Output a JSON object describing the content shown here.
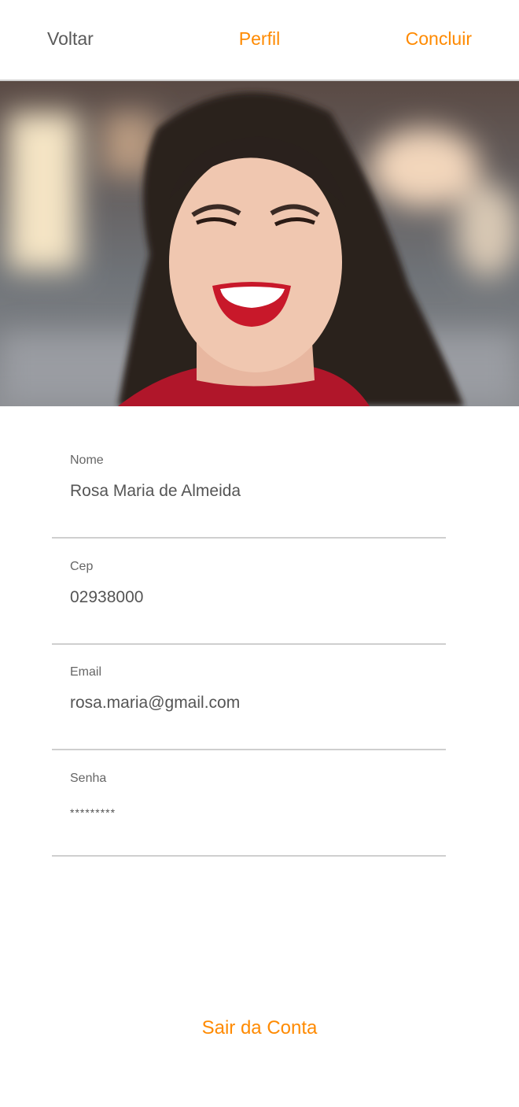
{
  "header": {
    "back_label": "Voltar",
    "title": "Perfil",
    "done_label": "Concluir"
  },
  "colors": {
    "accent": "#ff8a00",
    "text": "#555555"
  },
  "profile_photo": {
    "description_icon": "profile-photo"
  },
  "form": {
    "fields": [
      {
        "label": "Nome",
        "value": "Rosa Maria de Almeida"
      },
      {
        "label": "Cep",
        "value": "02938000"
      },
      {
        "label": "Email",
        "value": "rosa.maria@gmail.com"
      },
      {
        "label": "Senha",
        "value": "*********"
      }
    ]
  },
  "logout_label": "Sair da Conta"
}
